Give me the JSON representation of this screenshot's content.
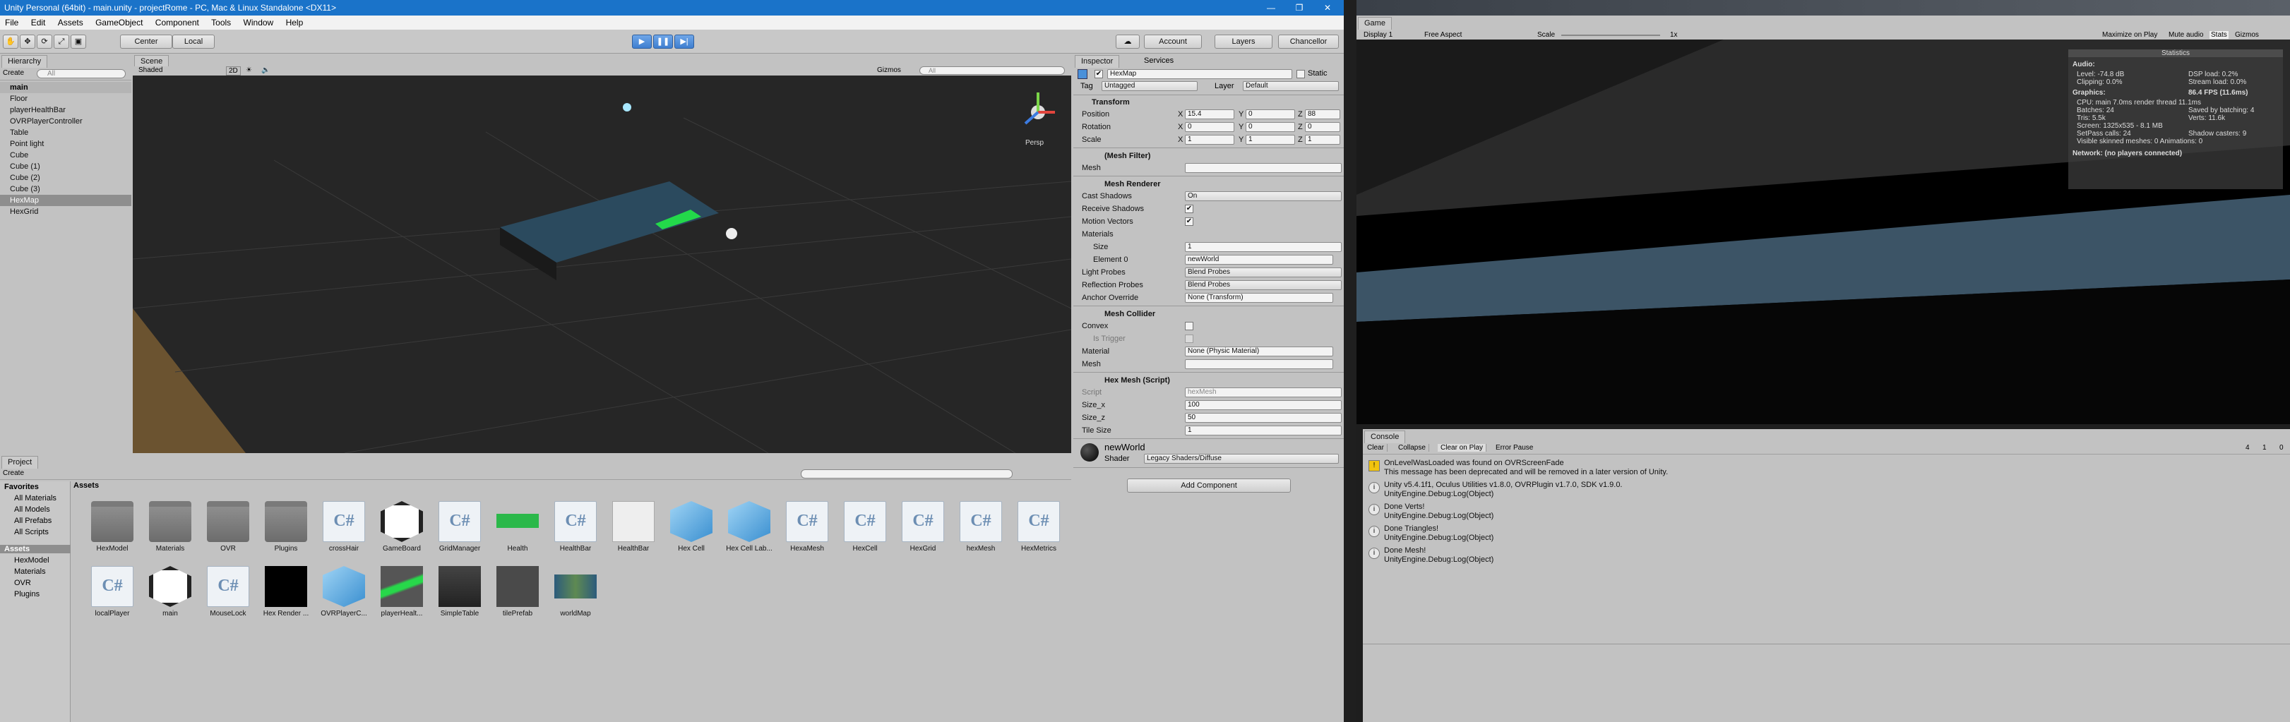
{
  "window_title": "Unity Personal (64bit) - main.unity - projectRome - PC, Mac & Linux Standalone <DX11>",
  "window_controls": {
    "minimize": "—",
    "maximize": "❐",
    "close": "✕"
  },
  "menu": [
    "File",
    "Edit",
    "Assets",
    "GameObject",
    "Component",
    "Tools",
    "Window",
    "Help"
  ],
  "toolbar": {
    "center": "Center",
    "local": "Local",
    "account": "Account",
    "layers": "Layers",
    "layout": "Chancellor"
  },
  "hierarchy": {
    "tab": "Hierarchy",
    "create": "Create",
    "search_placeholder": "All",
    "scene": "main",
    "items": [
      "Floor",
      "playerHealthBar",
      "OVRPlayerController",
      "Table",
      "Point light",
      "Cube",
      "Cube (1)",
      "Cube (2)",
      "Cube (3)",
      "HexMap",
      "HexGrid"
    ]
  },
  "scene": {
    "tab": "Scene",
    "shading": "Shaded",
    "mode2d": "2D",
    "gizmos": "Gizmos",
    "search_placeholder": "All",
    "persp": "Persp"
  },
  "inspector": {
    "tab": "Inspector",
    "tab2": "Services",
    "name": "HexMap",
    "static": "Static",
    "tag_label": "Tag",
    "tag": "Untagged",
    "layer_label": "Layer",
    "layer": "Default",
    "transform": {
      "title": "Transform",
      "position_label": "Position",
      "rotation_label": "Rotation",
      "scale_label": "Scale",
      "position": [
        "15.4",
        "0",
        "88"
      ],
      "rotation": [
        "0",
        "0",
        "0"
      ],
      "scale": [
        "1",
        "1",
        "1"
      ],
      "x": "X",
      "y": "Y",
      "z": "Z"
    },
    "mesh_filter": {
      "title": "(Mesh Filter)",
      "mesh_label": "Mesh"
    },
    "mesh_renderer": {
      "title": "Mesh Renderer",
      "cast_shadows_label": "Cast Shadows",
      "cast_shadows": "On",
      "receive_shadows_label": "Receive Shadows",
      "motion_vectors_label": "Motion Vectors",
      "materials_label": "Materials",
      "size_label": "Size",
      "size": "1",
      "element0_label": "Element 0",
      "element0": "newWorld",
      "light_probes_label": "Light Probes",
      "light_probes": "Blend Probes",
      "reflection_probes_label": "Reflection Probes",
      "reflection_probes": "Blend Probes",
      "anchor_label": "Anchor Override",
      "anchor": "None (Transform)"
    },
    "mesh_collider": {
      "title": "Mesh Collider",
      "convex_label": "Convex",
      "trigger_label": "Is Trigger",
      "material_label": "Material",
      "material": "None (Physic Material)",
      "mesh_label": "Mesh"
    },
    "hex_mesh": {
      "title": "Hex Mesh (Script)",
      "script_label": "Script",
      "script": "hexMesh",
      "size_x_label": "Size_x",
      "size_x": "100",
      "size_z_label": "Size_z",
      "size_z": "50",
      "tile_size_label": "Tile Size",
      "tile_size": "1"
    },
    "material": {
      "name": "newWorld",
      "shader_label": "Shader",
      "shader": "Legacy Shaders/Diffuse"
    },
    "add_component": "Add Component"
  },
  "project": {
    "tab": "Project",
    "create": "Create",
    "breadcrumb": "Assets",
    "favorites_label": "Favorites",
    "favorites": [
      "All Materials",
      "All Models",
      "All Prefabs",
      "All Scripts"
    ],
    "tree_root": "Assets",
    "tree": [
      "HexModel",
      "Materials",
      "OVR",
      "Plugins"
    ],
    "assets_row1": [
      {
        "name": "HexModel",
        "kind": "folder"
      },
      {
        "name": "Materials",
        "kind": "folder"
      },
      {
        "name": "OVR",
        "kind": "folder"
      },
      {
        "name": "Plugins",
        "kind": "folder"
      },
      {
        "name": "crossHair",
        "kind": "script"
      },
      {
        "name": "GameBoard",
        "kind": "unity"
      },
      {
        "name": "GridManager",
        "kind": "script"
      },
      {
        "name": "Health",
        "kind": "green"
      },
      {
        "name": "HealthBar",
        "kind": "script"
      },
      {
        "name": "HealthBar",
        "kind": "white"
      },
      {
        "name": "Hex Cell",
        "kind": "cube"
      },
      {
        "name": "Hex Cell Lab...",
        "kind": "cube"
      },
      {
        "name": "HexaMesh",
        "kind": "script"
      },
      {
        "name": "HexCell",
        "kind": "script"
      },
      {
        "name": "HexGrid",
        "kind": "script"
      },
      {
        "name": "hexMesh",
        "kind": "script"
      },
      {
        "name": "HexMetrics",
        "kind": "script"
      }
    ],
    "assets_row2": [
      {
        "name": "localPlayer",
        "kind": "script"
      },
      {
        "name": "main",
        "kind": "unity"
      },
      {
        "name": "MouseLock",
        "kind": "script"
      },
      {
        "name": "Hex Render ...",
        "kind": "black"
      },
      {
        "name": "OVRPlayerC...",
        "kind": "cube"
      },
      {
        "name": "playerHealt...",
        "kind": "greenbar"
      },
      {
        "name": "SimpleTable",
        "kind": "table"
      },
      {
        "name": "tilePrefab",
        "kind": "gray"
      },
      {
        "name": "worldMap",
        "kind": "map"
      }
    ]
  },
  "game": {
    "tab": "Game",
    "display": "Display 1",
    "aspect": "Free Aspect",
    "scale_label": "Scale",
    "scale_value": "1x",
    "buttons": [
      "Maximize on Play",
      "Mute audio",
      "Stats",
      "Gizmos"
    ],
    "stats": {
      "title": "Statistics",
      "audio_label": "Audio:",
      "level": "Level: -74.8 dB",
      "dsp_load": "DSP load: 0.2%",
      "clipping": "Clipping: 0.0%",
      "stream_load": "Stream load: 0.0%",
      "graphics_label": "Graphics:",
      "fps": "86.4 FPS (11.6ms)",
      "cpu": "CPU: main 7.0ms  render thread 11.1ms",
      "batches": "Batches: 24",
      "saved": "Saved by batching: 4",
      "tris": "Tris: 5.5k",
      "verts": "Verts: 11.6k",
      "screen": "Screen: 1325x535 - 8.1 MB",
      "setpass": "SetPass calls: 24",
      "shadow_casters": "Shadow casters: 9",
      "skinned": "Visible skinned meshes: 0  Animations: 0",
      "network": "Network: (no players connected)"
    }
  },
  "console": {
    "tab": "Console",
    "buttons": [
      "Clear",
      "Collapse",
      "Clear on Play",
      "Error Pause"
    ],
    "counts": [
      "4",
      "1",
      "0"
    ],
    "messages": [
      {
        "type": "warn",
        "l1": "OnLevelWasLoaded was found on OVRScreenFade",
        "l2": "This message has been deprecated and will be removed in a later version of Unity."
      },
      {
        "type": "info",
        "l1": "Unity v5.4.1f1, Oculus Utilities v1.8.0, OVRPlugin v1.7.0, SDK v1.9.0.",
        "l2": "UnityEngine.Debug:Log(Object)"
      },
      {
        "type": "info",
        "l1": "Done Verts!",
        "l2": "UnityEngine.Debug:Log(Object)"
      },
      {
        "type": "info",
        "l1": "Done Triangles!",
        "l2": "UnityEngine.Debug:Log(Object)"
      },
      {
        "type": "info",
        "l1": "Done Mesh!",
        "l2": "UnityEngine.Debug:Log(Object)"
      }
    ]
  }
}
